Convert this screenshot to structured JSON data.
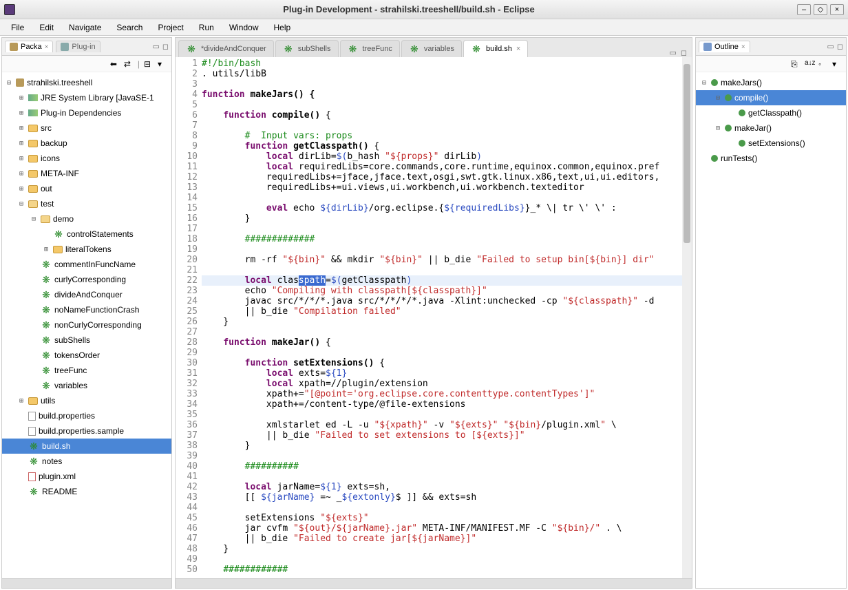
{
  "window": {
    "title": "Plug-in Development - strahilski.treeshell/build.sh - Eclipse"
  },
  "menubar": [
    "File",
    "Edit",
    "Navigate",
    "Search",
    "Project",
    "Run",
    "Window",
    "Help"
  ],
  "left_panel": {
    "tabs": [
      {
        "label": "Packa",
        "active": true
      },
      {
        "label": "Plug-in",
        "active": false
      }
    ],
    "project": "strahilski.treeshell",
    "jre": "JRE System Library [JavaSE-1",
    "plugin_deps": "Plug-in Dependencies",
    "folders": {
      "src": "src",
      "backup": "backup",
      "icons": "icons",
      "meta": "META-INF",
      "out": "out",
      "test": "test",
      "demo": "demo",
      "utils": "utils"
    },
    "demo_children": [
      "controlStatements",
      "literalTokens"
    ],
    "test_files": [
      "commentInFuncName",
      "curlyCorresponding",
      "divideAndConquer",
      "noNameFunctionCrash",
      "nonCurlyCorresponding",
      "subShells",
      "tokensOrder",
      "treeFunc",
      "variables"
    ],
    "root_files": {
      "build_props": "build.properties",
      "build_props_sample": "build.properties.sample",
      "build_sh": "build.sh",
      "notes": "notes",
      "plugin_xml": "plugin.xml",
      "readme": "README"
    }
  },
  "editor": {
    "tabs": [
      {
        "label": "*divideAndConquer",
        "active": false,
        "icon": "tree"
      },
      {
        "label": "subShells",
        "active": false,
        "icon": "tree"
      },
      {
        "label": "treeFunc",
        "active": false,
        "icon": "tree"
      },
      {
        "label": "variables",
        "active": false,
        "icon": "tree"
      },
      {
        "label": "build.sh",
        "active": true,
        "icon": "tree",
        "closeable": true
      }
    ]
  },
  "code_lines": [
    {
      "n": 1,
      "html": "<span class='cm'>#!/bin/bash</span>"
    },
    {
      "n": 2,
      "html": ". utils/libB"
    },
    {
      "n": 3,
      "html": ""
    },
    {
      "n": 4,
      "html": "<span class='kw'>function</span> <span class='fn'>makeJars()</span> {",
      "bold": true
    },
    {
      "n": 5,
      "html": ""
    },
    {
      "n": 6,
      "html": "    <span class='kw'>function</span> <span class='fn'>compile()</span> {"
    },
    {
      "n": 7,
      "html": ""
    },
    {
      "n": 8,
      "html": "        <span class='cm'>#  Input vars: props</span>"
    },
    {
      "n": 9,
      "html": "        <span class='kw'>function</span> <span class='fn'>getClasspath()</span> {"
    },
    {
      "n": 10,
      "html": "            <span class='kw'>local</span> dirLib=<span class='var'>$(</span>b_hash <span class='str'>\"${props}\"</span> dirLib<span class='var'>)</span>"
    },
    {
      "n": 11,
      "html": "            <span class='kw'>local</span> requiredLibs=core.commands,core.runtime,equinox.common,equinox.pref"
    },
    {
      "n": 12,
      "html": "            requiredLibs+=jface,jface.text,osgi,swt.gtk.linux.x86,text,ui,ui.editors,"
    },
    {
      "n": 13,
      "html": "            requiredLibs+=ui.views,ui.workbench,ui.workbench.texteditor"
    },
    {
      "n": 14,
      "html": ""
    },
    {
      "n": 15,
      "html": "            <span class='kw'>eval</span> echo <span class='var'>${dirLib}</span>/org.eclipse.{<span class='var'>${requiredLibs}</span>}_* \\| tr \\' \\' :"
    },
    {
      "n": 16,
      "html": "        }"
    },
    {
      "n": 17,
      "html": ""
    },
    {
      "n": 18,
      "html": "        <span class='cm'>#############</span>"
    },
    {
      "n": 19,
      "html": ""
    },
    {
      "n": 20,
      "html": "        rm -rf <span class='str'>\"${bin}\"</span> &amp;&amp; mkdir <span class='str'>\"${bin}\"</span> || b_die <span class='str'>\"Failed to setup bin[${bin}] dir\"</span>"
    },
    {
      "n": 21,
      "html": ""
    },
    {
      "n": 22,
      "html": "        <span class='kw'>local</span> clas<span class='hl-sel'>spath</span>=<span class='var'>$(</span>getClasspath<span class='var'>)</span>",
      "hl": true
    },
    {
      "n": 23,
      "html": "        echo <span class='str'>\"Compiling with classpath[${classpath}]\"</span>"
    },
    {
      "n": 24,
      "html": "        javac src/*/*/*.java src/*/*/*/*.java -Xlint:unchecked -cp <span class='str'>\"${classpath}\"</span> -d"
    },
    {
      "n": 25,
      "html": "        || b_die <span class='str'>\"Compilation failed\"</span>"
    },
    {
      "n": 26,
      "html": "    }"
    },
    {
      "n": 27,
      "html": ""
    },
    {
      "n": 28,
      "html": "    <span class='kw'>function</span> <span class='fn'>makeJar()</span> {"
    },
    {
      "n": 29,
      "html": ""
    },
    {
      "n": 30,
      "html": "        <span class='kw'>function</span> <span class='fn'>setExtensions()</span> {"
    },
    {
      "n": 31,
      "html": "            <span class='kw'>local</span> exts=<span class='var'>${1}</span>"
    },
    {
      "n": 32,
      "html": "            <span class='kw'>local</span> xpath=//plugin/extension"
    },
    {
      "n": 33,
      "html": "            xpath+=<span class='str'>\"[@point='org.eclipse.core.contenttype.contentTypes']\"</span>"
    },
    {
      "n": 34,
      "html": "            xpath+=/content-type/@file-extensions"
    },
    {
      "n": 35,
      "html": ""
    },
    {
      "n": 36,
      "html": "            xmlstarlet ed -L -u <span class='str'>\"${xpath}\"</span> -v <span class='str'>\"${exts}\"</span> <span class='str'>\"${bin}</span>/plugin.xml<span class='str'>\"</span> \\"
    },
    {
      "n": 37,
      "html": "            || b_die <span class='str'>\"Failed to set extensions to [${exts}]\"</span>"
    },
    {
      "n": 38,
      "html": "        }"
    },
    {
      "n": 39,
      "html": ""
    },
    {
      "n": 40,
      "html": "        <span class='cm'>##########</span>"
    },
    {
      "n": 41,
      "html": ""
    },
    {
      "n": 42,
      "html": "        <span class='kw'>local</span> jarName=<span class='var'>${1}</span> exts=sh,"
    },
    {
      "n": 43,
      "html": "        [[ <span class='var'>${jarName}</span> =~ _<span class='var'>${extonly}</span>$ ]] &amp;&amp; exts=sh"
    },
    {
      "n": 44,
      "html": ""
    },
    {
      "n": 45,
      "html": "        setExtensions <span class='str'>\"${exts}\"</span>"
    },
    {
      "n": 46,
      "html": "        jar cvfm <span class='str'>\"${out}/${jarName}.jar\"</span> META-INF/MANIFEST.MF -C <span class='str'>\"${bin}/\"</span> . \\"
    },
    {
      "n": 47,
      "html": "        || b_die <span class='str'>\"Failed to create jar[${jarName}]\"</span>"
    },
    {
      "n": 48,
      "html": "    }"
    },
    {
      "n": 49,
      "html": ""
    },
    {
      "n": 50,
      "html": "    <span class='cm'>############</span>"
    }
  ],
  "outline": {
    "tab": "Outline",
    "items": [
      {
        "label": "makeJars()",
        "depth": 0,
        "exp": "⊟"
      },
      {
        "label": "compile()",
        "depth": 1,
        "exp": "⊟",
        "sel": true
      },
      {
        "label": "getClasspath()",
        "depth": 2,
        "exp": ""
      },
      {
        "label": "makeJar()",
        "depth": 1,
        "exp": "⊟"
      },
      {
        "label": "setExtensions()",
        "depth": 2,
        "exp": ""
      },
      {
        "label": "runTests()",
        "depth": 0,
        "exp": ""
      }
    ]
  }
}
